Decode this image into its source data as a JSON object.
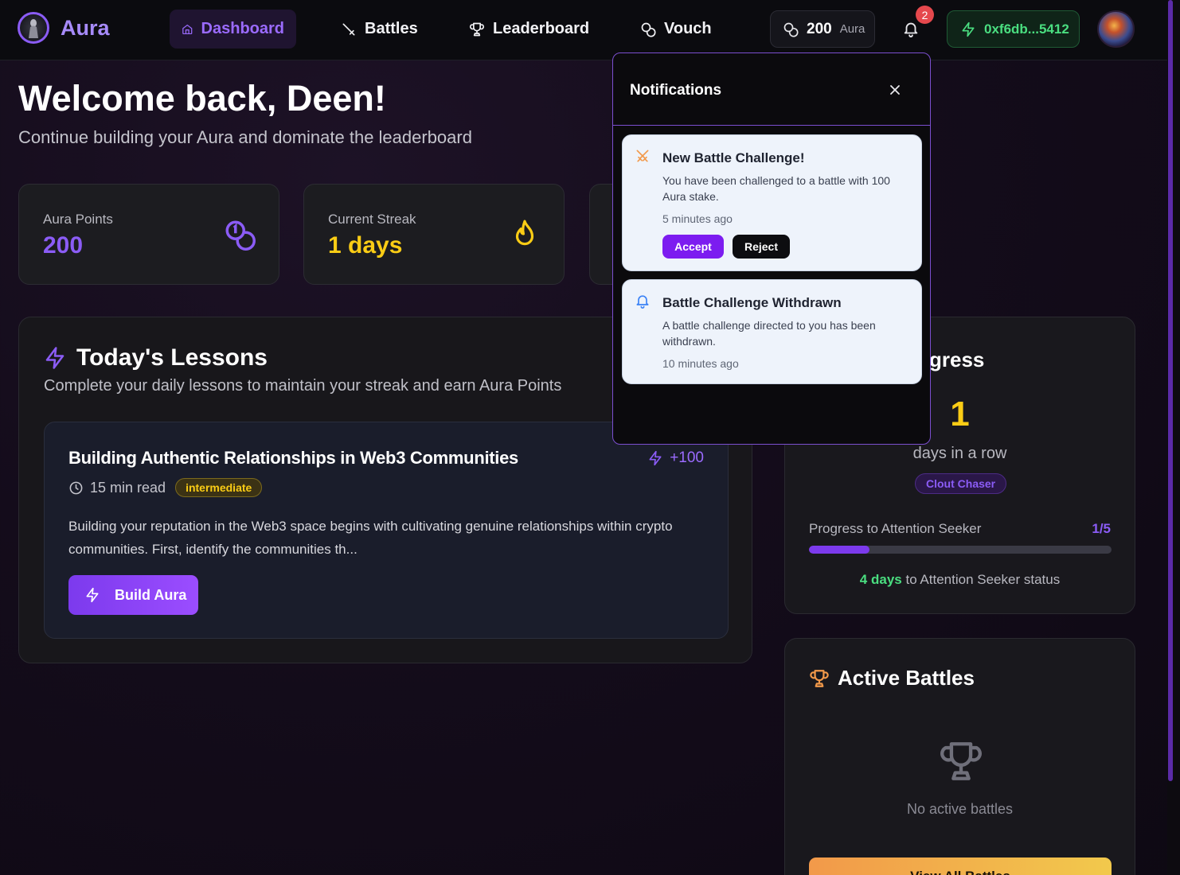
{
  "app": {
    "name": "Aura"
  },
  "nav": {
    "items": [
      {
        "label": "Dashboard",
        "icon": "home-icon",
        "active": true
      },
      {
        "label": "Battles",
        "icon": "sword-icon"
      },
      {
        "label": "Leaderboard",
        "icon": "trophy-icon"
      },
      {
        "label": "Vouch",
        "icon": "coins-icon"
      }
    ]
  },
  "header": {
    "points_value": "200",
    "points_label": "Aura",
    "notification_count": "2",
    "wallet_address": "0xf6db...5412"
  },
  "welcome": {
    "title": "Welcome back, Deen!",
    "subtitle": "Continue building your Aura and dominate the leaderboard"
  },
  "stats": [
    {
      "label": "Aura Points",
      "value": "200",
      "color": "#8b5cf6"
    },
    {
      "label": "Current Streak",
      "value": "1 days",
      "color": "#facc15"
    }
  ],
  "lessons": {
    "title": "Today's Lessons",
    "subtitle": "Complete your daily lessons to maintain your streak and earn Aura Points",
    "card": {
      "title": "Building Authentic Relationships in Web3 Communities",
      "reward": "+100",
      "read_time": "15 min read",
      "level": "intermediate",
      "excerpt": "Building your reputation in the Web3 space begins with cultivating genuine relationships within crypto communities. First, identify the communities th...",
      "button_label": "Build Aura"
    }
  },
  "streak_progress": {
    "title_visible": "gress",
    "days": "1",
    "days_label": "days in a row",
    "rank": "Clout Chaser",
    "progress_label": "Progress to Attention Seeker",
    "progress_count": "1/5",
    "progress_fraction": 0.2,
    "remaining_days": "4 days",
    "remaining_text": "to Attention Seeker status"
  },
  "battles": {
    "title": "Active Battles",
    "empty_text": "No active battles",
    "button_label": "View All Battles"
  },
  "notifications": {
    "title": "Notifications",
    "items": [
      {
        "icon": "crossed-swords-icon",
        "title": "New Battle Challenge!",
        "text": "You have been challenged to a battle with 100 Aura stake.",
        "time": "5 minutes ago",
        "accept_label": "Accept",
        "reject_label": "Reject"
      },
      {
        "icon": "bell-icon",
        "title": "Battle Challenge Withdrawn",
        "text": "A battle challenge directed to you has been withdrawn.",
        "time": "10 minutes ago"
      }
    ]
  },
  "colors": {
    "accent": "#8b5cf6",
    "streak": "#facc15",
    "wallet": "#4ade80",
    "battle_orange": "#f2994a"
  }
}
